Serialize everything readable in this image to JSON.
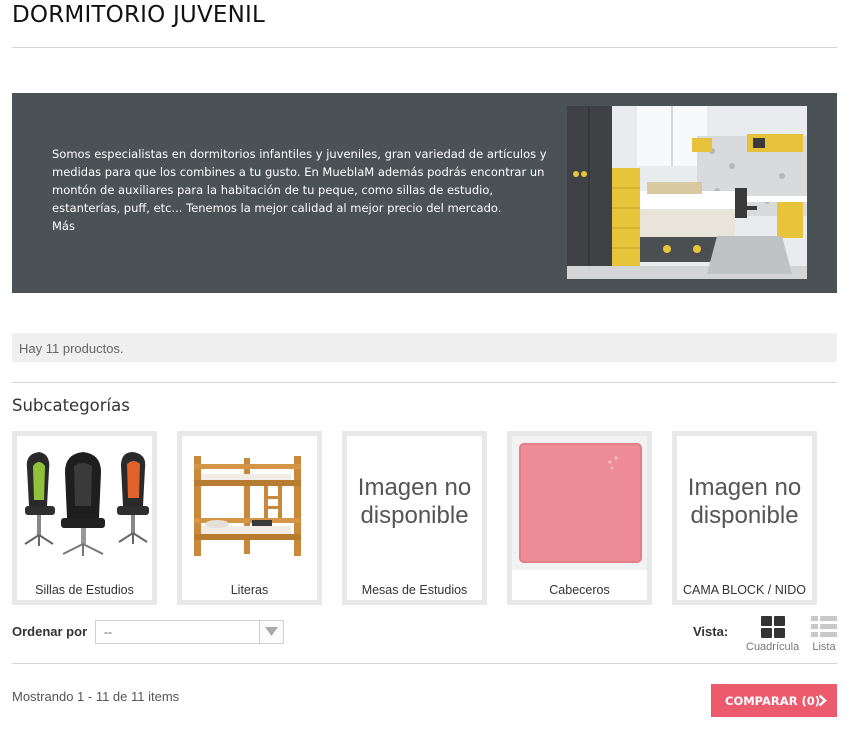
{
  "page": {
    "title": "DORMITORIO JUVENIL"
  },
  "banner": {
    "description": "Somos especialistas en dormitorios infantiles y juveniles, gran variedad de artículos y medidas para que los combines a tu gusto. En MueblaM además podrás encontrar un montón de auxiliares para la habitación de tu peque, como sillas de estudio, estanterías, puff, etc... Tenemos la mejor calidad al mejor precio del mercado.",
    "more_link": "Más"
  },
  "product_count": "Hay 11 productos.",
  "subcategories": {
    "heading": "Subcategorías",
    "items": [
      {
        "name": "Sillas de Estudios",
        "image": "office-chairs-photo"
      },
      {
        "name": "Literas",
        "image": "bunk-bed-photo"
      },
      {
        "name": "Mesas de Estudios",
        "image": "no-image",
        "placeholder": "Imagen no disponible"
      },
      {
        "name": "Cabeceros",
        "image": "pink-headboard-photo"
      },
      {
        "name": "CAMA BLOCK / NIDO",
        "image": "no-image",
        "placeholder": "Imagen no disponible"
      }
    ]
  },
  "sort": {
    "label": "Ordenar por",
    "selected": "--"
  },
  "view": {
    "label": "Vista:",
    "options": [
      {
        "label": "Cuadrícula",
        "icon": "grid-icon",
        "active": true
      },
      {
        "label": "Lista",
        "icon": "list-icon",
        "active": false
      }
    ]
  },
  "pagination": {
    "showing": "Mostrando 1 - 11 de 11 items"
  },
  "compare": {
    "label": "COMPARAR (0)",
    "icon": "chevron-right-icon"
  },
  "colors": {
    "banner_bg": "#4a5256",
    "compare_button": "#ec5a6e",
    "card_border": "#e8e8e8"
  }
}
